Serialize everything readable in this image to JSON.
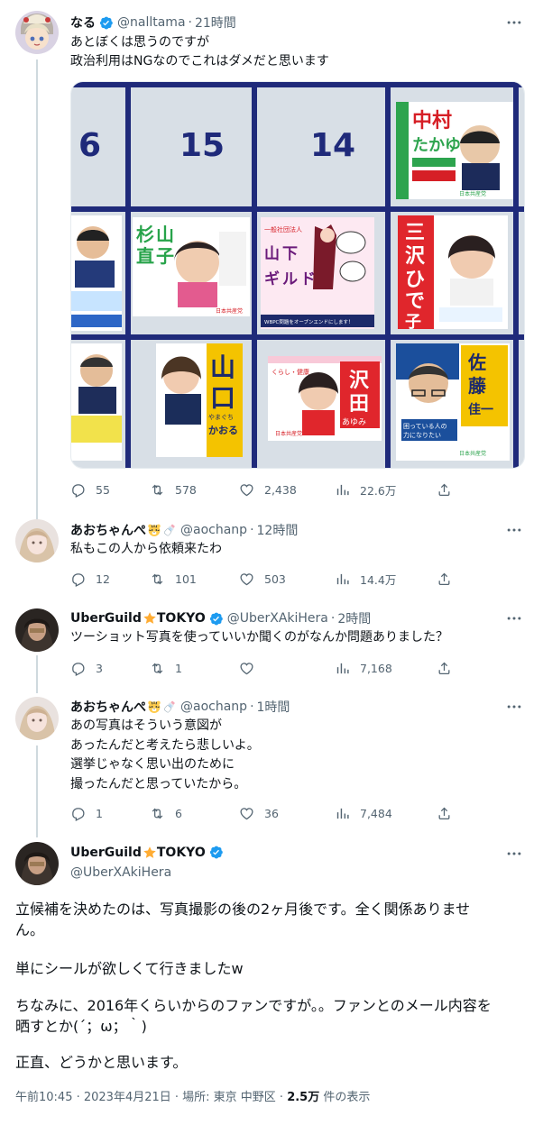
{
  "colors": {
    "accent": "#1d9bf0",
    "text": "#0f1419",
    "muted": "#536471",
    "border": "#cfd9de"
  },
  "tweet1": {
    "name": "なる",
    "handle": "@nalltama",
    "time": "21時間",
    "text": "あとぼくは思うのですが\n政治利用はNGなのでこれはダメだと思います",
    "photo": {
      "numbers": [
        "6",
        "15",
        "14"
      ],
      "posters": {
        "nakamura_name": "中村\nたかゆき",
        "nakamura_party": "日本共産党",
        "sugiyama_name": "杉\n山\n直\n子",
        "sugiyama_party": "日本共産党",
        "yamashita_name": "山\n下\nギ\nル\nド",
        "yamashita_sub": "WBPC問題をオープンエンドにします！",
        "misawa_name": "三\n沢\nひ\nで\n子",
        "yamaguchi_name": "山\n口",
        "yamaguchi_kana": "やまぐち\nかおる",
        "sawada_name": "沢\n田",
        "sawada_kana": "あゆみ",
        "sawada_party": "日本共産党",
        "sato_name": "佐\n藤\n佳\n一",
        "sato_slogan": "困っている人の\n力になりたい",
        "sato_party": "日本共産党"
      }
    },
    "replies": "55",
    "retweets": "578",
    "likes": "2,438",
    "views": "22.6万"
  },
  "tweet2": {
    "name": "あおちゃんぺ",
    "handle": "@aochanp",
    "time": "12時間",
    "text": "私もこの人から依頼来たわ",
    "replies": "12",
    "retweets": "101",
    "likes": "503",
    "views": "14.4万"
  },
  "tweet3": {
    "name_pre": "UberGuild",
    "name_post": "TOKYO",
    "handle": "@UberXAkiHera",
    "time": "2時間",
    "text": "ツーショット写真を使っていいか聞くのがなんか問題ありました？",
    "replies": "3",
    "retweets": "1",
    "likes": "",
    "views": "7,168"
  },
  "tweet4": {
    "name": "あおちゃんぺ",
    "handle": "@aochanp",
    "time": "1時間",
    "text": "あの写真はそういう意図が\nあったんだと考えたら悲しいよ。\n選挙じゃなく思い出のために\n撮ったんだと思っていたから。",
    "replies": "1",
    "retweets": "6",
    "likes": "36",
    "views": "7,484"
  },
  "main": {
    "name_pre": "UberGuild",
    "name_post": "TOKYO",
    "handle": "@UberXAkiHera",
    "para1": "立候補を決めたのは、写真撮影の後の2ヶ月後です。全く関係ありませ\nん。",
    "para2": "単にシールが欲しくて行きましたw",
    "para3": "ちなみに、2016年くらいからのファンですが。。ファンとのメール内容を\n晒すとか(´；ω；｀)",
    "para4": "正直、どうかと思います。",
    "meta_time": "午前10:45 · 2023年4月21日 · 場所: 東京 中野区 · ",
    "meta_views": "2.5万",
    "meta_suffix": " 件の表示"
  },
  "icons": [
    "reply-icon",
    "retweet-icon",
    "like-icon",
    "views-icon",
    "share-icon",
    "more-icon",
    "verified-icon",
    "star-emoji",
    "tiger-emoji",
    "bottle-emoji"
  ]
}
